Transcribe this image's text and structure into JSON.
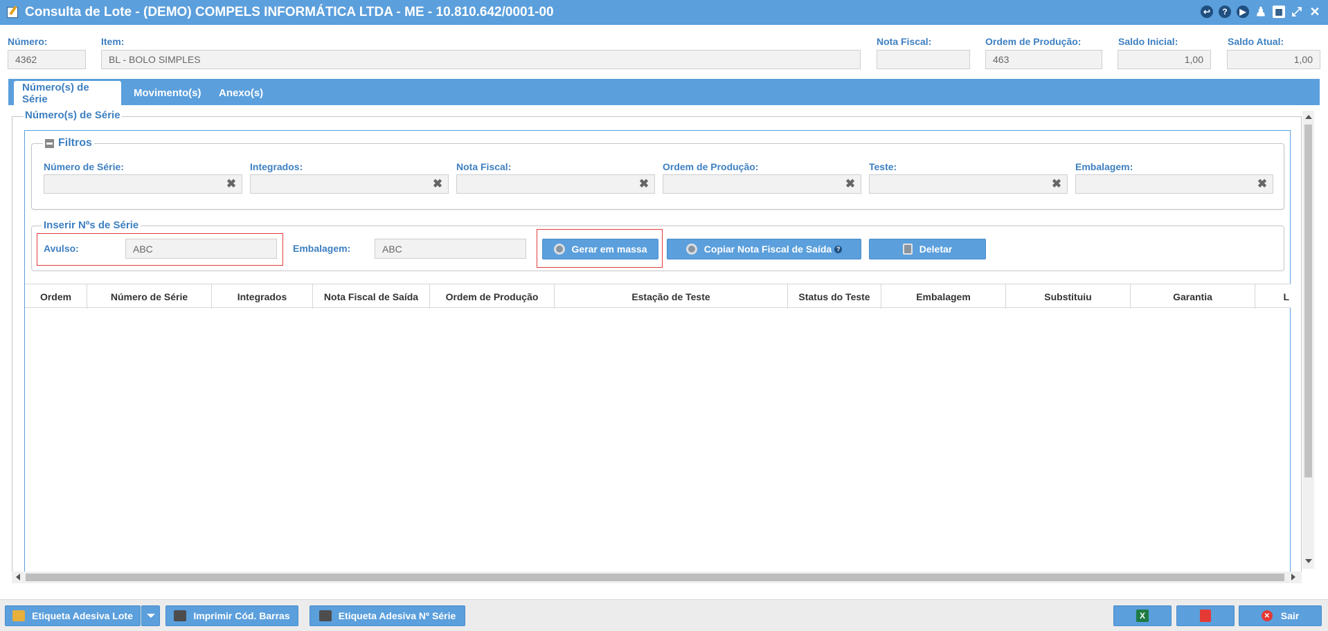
{
  "window": {
    "title": "Consulta de Lote - (DEMO) COMPELS INFORMÁTICA LTDA - ME - 10.810.642/0001-00",
    "icons": [
      "window-icon",
      "back-icon",
      "help-icon",
      "play-icon",
      "user-icon",
      "calendar-icon",
      "collapse-icon",
      "close-icon"
    ]
  },
  "header": {
    "numero_label": "Número:",
    "numero_value": "4362",
    "item_label": "Item:",
    "item_value": "BL - BOLO SIMPLES",
    "nota_fiscal_label": "Nota Fiscal:",
    "nota_fiscal_value": "",
    "ordem_producao_label": "Ordem de Produção:",
    "ordem_producao_value": "463",
    "saldo_inicial_label": "Saldo Inicial:",
    "saldo_inicial_value": "1,00",
    "saldo_atual_label": "Saldo Atual:",
    "saldo_atual_value": "1,00"
  },
  "tabs": [
    {
      "label": "Número(s) de Série",
      "active": true
    },
    {
      "label": "Movimento(s)",
      "active": false
    },
    {
      "label": "Anexo(s)",
      "active": false
    }
  ],
  "section": {
    "title": "Número(s) de Série"
  },
  "filters": {
    "title": "Filtros",
    "fields": [
      {
        "label": "Número de Série:",
        "value": ""
      },
      {
        "label": "Integrados:",
        "value": ""
      },
      {
        "label": "Nota Fiscal:",
        "value": ""
      },
      {
        "label": "Ordem de Produção:",
        "value": ""
      },
      {
        "label": "Teste:",
        "value": ""
      },
      {
        "label": "Embalagem:",
        "value": ""
      }
    ]
  },
  "insert": {
    "title": "Inserir Nºs de Série",
    "avulso_label": "Avulso:",
    "avulso_placeholder": "ABC",
    "embalagem_label": "Embalagem:",
    "embalagem_placeholder": "ABC",
    "gerar_label": "Gerar em massa",
    "copiar_label": "Copiar Nota Fiscal de Saída",
    "deletar_label": "Deletar"
  },
  "grid": {
    "columns": [
      "Ordem",
      "Número de Série",
      "Integrados",
      "Nota Fiscal de Saída",
      "Ordem de Produção",
      "Estação de Teste",
      "Status do Teste",
      "Embalagem",
      "Substituiu",
      "Garantia",
      "L"
    ],
    "rows": []
  },
  "footer": {
    "etiqueta_lote_label": "Etiqueta Adesiva Lote",
    "imprimir_label": "Imprimir Cód. Barras",
    "etiqueta_serie_label": "Etiqueta Adesiva Nº Série",
    "sair_label": "Sair"
  },
  "colors": {
    "accent": "#5b9fdc",
    "label": "#3d7fc1",
    "highlight": "#e23b3b"
  }
}
